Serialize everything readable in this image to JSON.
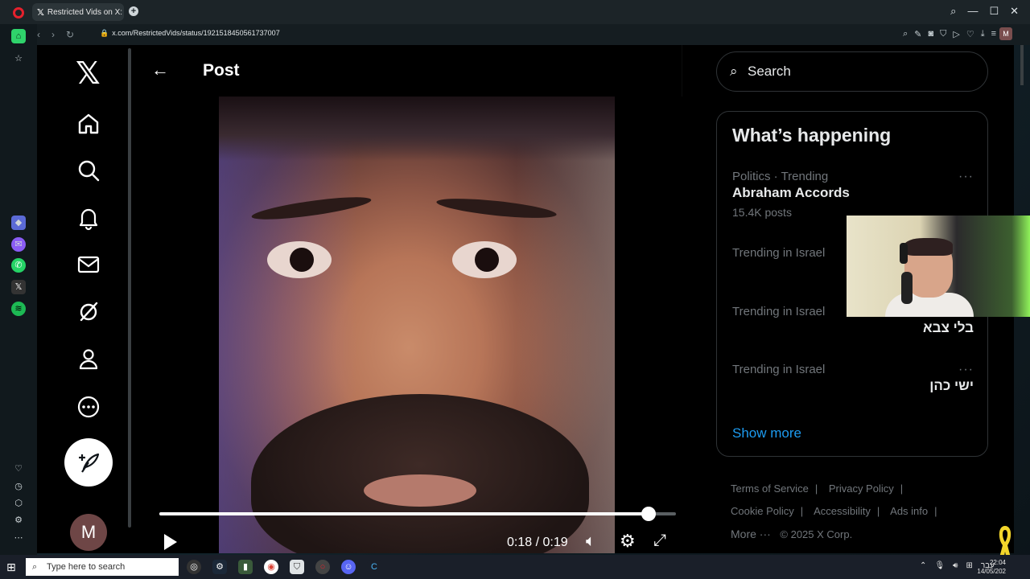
{
  "browser": {
    "tab_title": "Restricted Vids on X: \"A fa",
    "url": "x.com/RestrictedVids/status/1921518450561737007",
    "profile_initial": "M"
  },
  "x": {
    "logo": "X",
    "header_title": "Post",
    "user_initial": "M",
    "video": {
      "time_display": "0:18 / 0:19",
      "progress": 0.947
    },
    "search_placeholder": "Search",
    "happening_title": "What’s happening",
    "trends": [
      {
        "context": "Politics · Trending",
        "name": "Abraham Accords",
        "count": "15.4K posts"
      },
      {
        "context": "Trending in Israel",
        "name": "",
        "count": ""
      },
      {
        "context": "Trending in Israel",
        "name": "בלי צבא",
        "count": ""
      },
      {
        "context": "Trending in Israel",
        "name": "ישי כהן",
        "count": ""
      }
    ],
    "show_more": "Show more",
    "footer": {
      "terms": "Terms of Service",
      "privacy": "Privacy Policy",
      "cookie": "Cookie Policy",
      "accessibility": "Accessibility",
      "ads": "Ads info",
      "more": "More ···",
      "copyright": "© 2025 X Corp."
    }
  },
  "taskbar": {
    "search_placeholder": "Type here to search",
    "time": "22:04",
    "date": "14/05/202",
    "lang": "עבר"
  },
  "colors": {
    "accent": "#1d9bf0",
    "opera_red": "#e5212d",
    "ribbon": "#f3d62b"
  }
}
